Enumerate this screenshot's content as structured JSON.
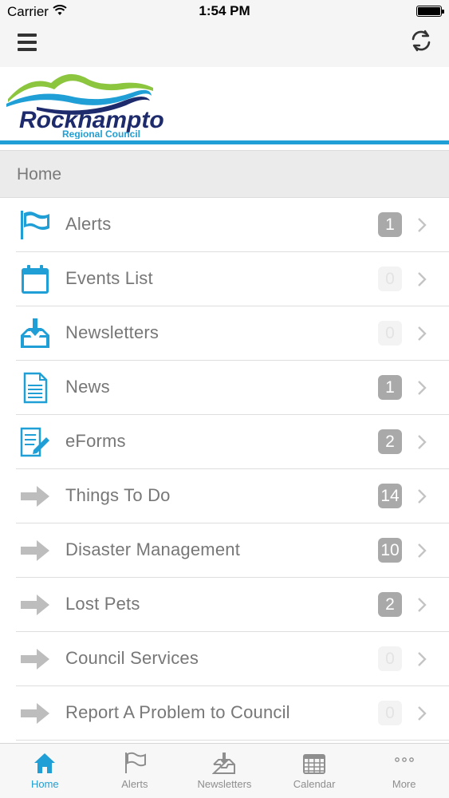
{
  "status_bar": {
    "carrier": "Carrier",
    "time": "1:54 PM"
  },
  "nav": {
    "menu_icon": "hamburger-menu-icon",
    "refresh_icon": "refresh-icon"
  },
  "logo": {
    "name": "Rockhampton",
    "subtitle": "Regional Council"
  },
  "section": {
    "title": "Home"
  },
  "list": [
    {
      "label": "Alerts",
      "count": "1",
      "icon": "flag-icon"
    },
    {
      "label": "Events List",
      "count": "0",
      "icon": "calendar-icon"
    },
    {
      "label": "Newsletters",
      "count": "0",
      "icon": "inbox-download-icon"
    },
    {
      "label": "News",
      "count": "1",
      "icon": "document-icon"
    },
    {
      "label": "eForms",
      "count": "2",
      "icon": "form-edit-icon"
    },
    {
      "label": "Things To Do",
      "count": "14",
      "icon": "arrow-right-icon"
    },
    {
      "label": "Disaster Management",
      "count": "10",
      "icon": "arrow-right-icon"
    },
    {
      "label": "Lost Pets",
      "count": "2",
      "icon": "arrow-right-icon"
    },
    {
      "label": "Council Services",
      "count": "0",
      "icon": "arrow-right-icon"
    },
    {
      "label": "Report A Problem to Council",
      "count": "0",
      "icon": "arrow-right-icon"
    }
  ],
  "tabs": [
    {
      "label": "Home",
      "icon": "home-icon",
      "active": true
    },
    {
      "label": "Alerts",
      "icon": "flag-icon",
      "active": false
    },
    {
      "label": "Newsletters",
      "icon": "inbox-download-icon",
      "active": false
    },
    {
      "label": "Calendar",
      "icon": "calendar-icon",
      "active": false
    },
    {
      "label": "More",
      "icon": "more-dots-icon",
      "active": false
    }
  ],
  "colors": {
    "accent": "#1f9fd5",
    "badge": "#a9a9a9",
    "badge_zero": "#f3f3f3",
    "text": "#777777",
    "logo_navy": "#1d2a6b",
    "logo_green": "#8cc63f"
  }
}
